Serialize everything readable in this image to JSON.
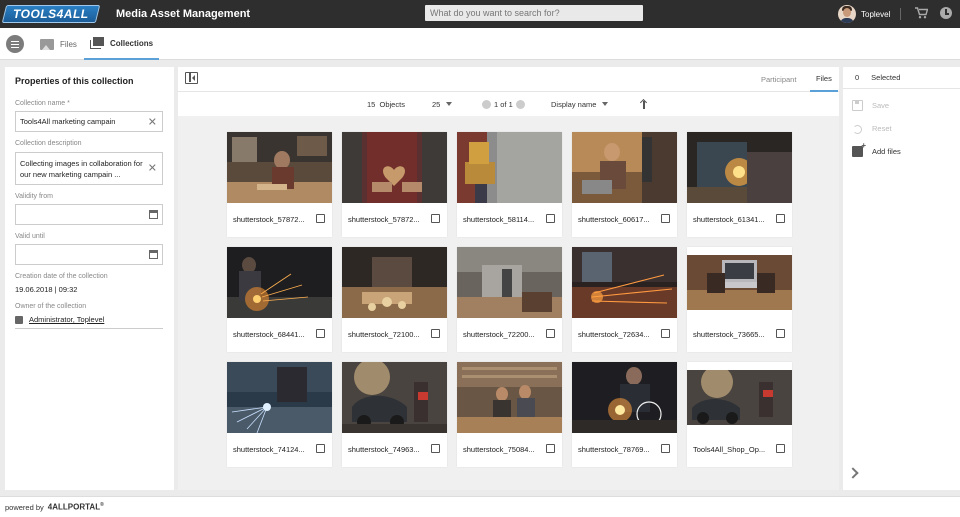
{
  "header": {
    "logo_text": "TOOLS4ALL",
    "app_title": "Media Asset Management",
    "search_placeholder": "What do you want to search for?",
    "user_name": "Toplevel"
  },
  "nav": {
    "tabs": [
      {
        "label": "Files",
        "active": false
      },
      {
        "label": "Collections",
        "active": true
      }
    ]
  },
  "properties": {
    "title": "Properties of this collection",
    "name_label": "Collection name *",
    "name_value": "Tools4All marketing campain",
    "description_label": "Collection description",
    "description_value": "Collecting images in collaboration for our new marketing campain ...",
    "validity_from_label": "Validity from",
    "valid_until_label": "Valid until",
    "creation_label": "Creation date of the collection",
    "creation_value": "19.06.2018 | 09:32",
    "owner_label": "Owner of the collection",
    "owner_value": "Administrator, Toplevel"
  },
  "content": {
    "view_tabs": [
      {
        "label": "Participant",
        "active": false
      },
      {
        "label": "Files",
        "active": true
      }
    ],
    "objects_count": "15",
    "objects_label": "Objects",
    "page_size": "25",
    "pagination": "1 of 1",
    "sort_label": "Display name",
    "files": [
      "shutterstock_57872...",
      "shutterstock_57872...",
      "shutterstock_58114...",
      "shutterstock_60617...",
      "shutterstock_61341...",
      "shutterstock_68441...",
      "shutterstock_72100...",
      "shutterstock_72200...",
      "shutterstock_72634...",
      "shutterstock_73665...",
      "shutterstock_74124...",
      "shutterstock_74963...",
      "shutterstock_75084...",
      "shutterstock_78769...",
      "Tools4All_Shop_Op..."
    ]
  },
  "actions": {
    "selected_count": "0",
    "selected_label": "Selected",
    "save_label": "Save",
    "reset_label": "Reset",
    "add_files_label": "Add files"
  },
  "footer": {
    "powered_by": "powered by",
    "brand": "4ALLPORTAL",
    "registered": "®"
  },
  "colors": {
    "topbar": "#2e2e2e",
    "accent": "#5ba0d6",
    "logo_blue": "#1c5d98"
  }
}
